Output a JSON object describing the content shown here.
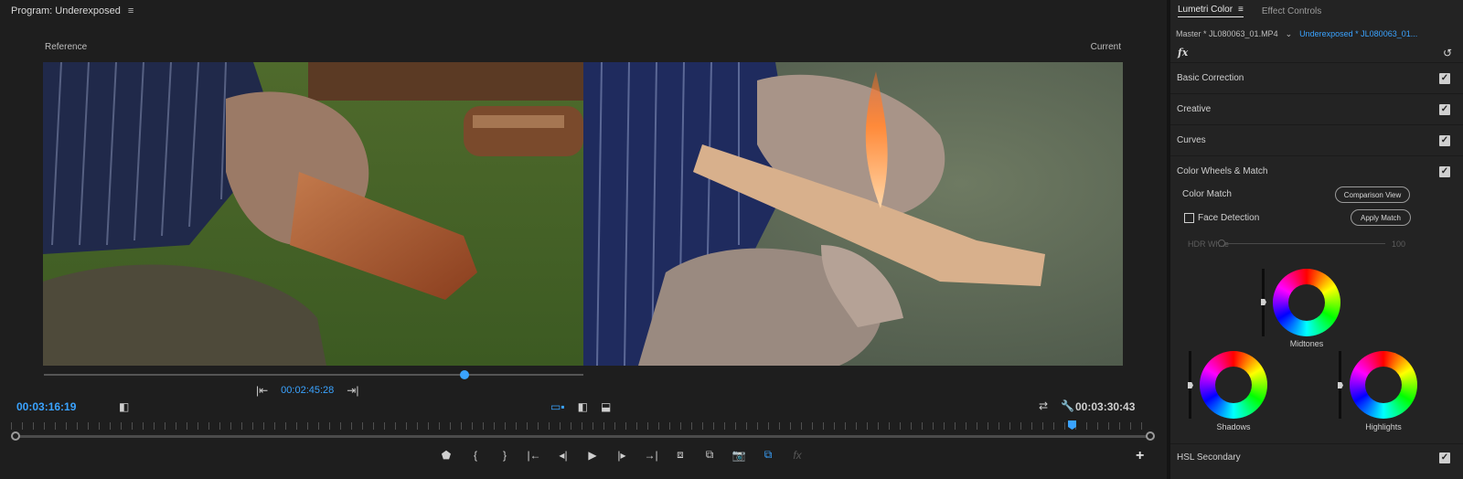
{
  "program": {
    "title": "Program: Underexposed",
    "reference_label": "Reference",
    "current_label": "Current",
    "reference_time": "00:02:45:28",
    "current_time": "00:03:16:19",
    "end_time": "00:03:30:43"
  },
  "lumetri": {
    "tabs": [
      "Lumetri Color",
      "Effect Controls"
    ],
    "master_clip": "Master * JL080063_01.MP4",
    "target_clip": "Underexposed * JL080063_01...",
    "fx_label": "fx",
    "sections": [
      "Basic Correction",
      "Creative",
      "Curves",
      "Color Wheels & Match"
    ],
    "color_match_label": "Color Match",
    "comparison_view_label": "Comparison View",
    "face_detection_label": "Face Detection",
    "apply_match_label": "Apply Match",
    "hdr_white_label": "HDR White",
    "hdr_white_value": "100",
    "wheels": [
      "Midtones",
      "Shadows",
      "Highlights"
    ],
    "hsl_label": "HSL Secondary"
  },
  "icons": {
    "accent": "#3aa3ff"
  }
}
